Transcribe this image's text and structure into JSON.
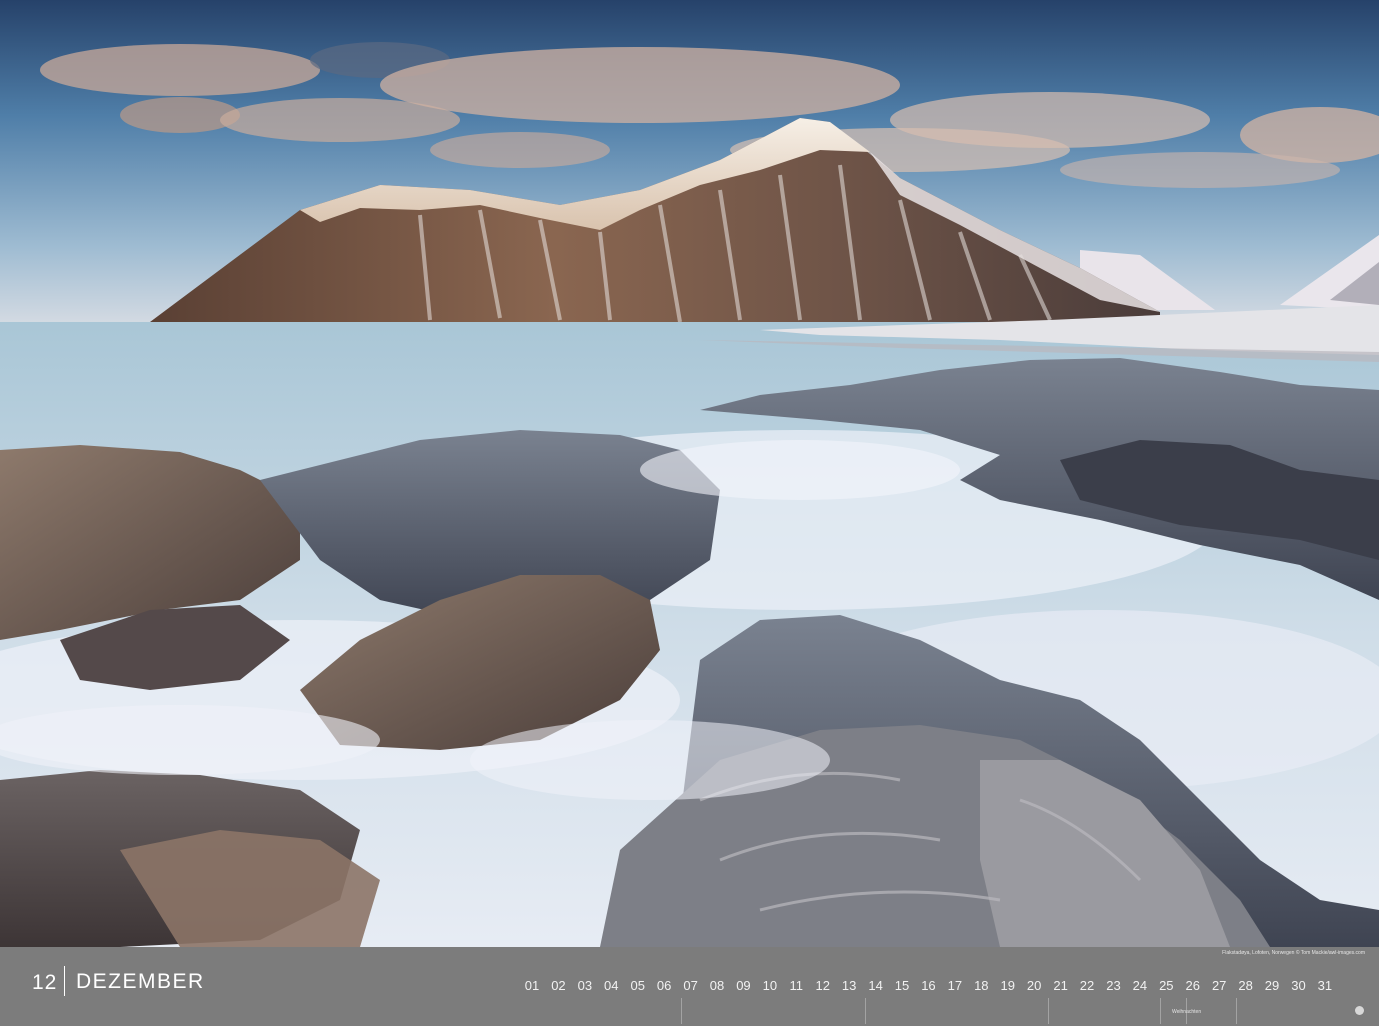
{
  "calendar": {
    "month_number": "12",
    "month_name": "DEZEMBER",
    "days": [
      "01",
      "02",
      "03",
      "04",
      "05",
      "06",
      "07",
      "08",
      "09",
      "10",
      "11",
      "12",
      "13",
      "14",
      "15",
      "16",
      "17",
      "18",
      "19",
      "20",
      "21",
      "22",
      "23",
      "24",
      "25",
      "26",
      "27",
      "28",
      "29",
      "30",
      "31"
    ],
    "holiday_label": "Weihnachten",
    "photo_credit": "Flakstadøya, Lofoten, Norwegen © Tom Mackie/awl-images.com"
  },
  "colors": {
    "footer_bar": "#7c7c7c",
    "footer_text": "#ffffff"
  }
}
